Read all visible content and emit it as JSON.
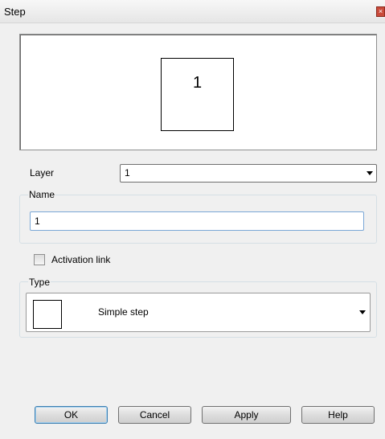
{
  "window": {
    "title": "Step"
  },
  "preview": {
    "step_label": "1"
  },
  "layer": {
    "label": "Layer",
    "selected": "1"
  },
  "name": {
    "group_title": "Name",
    "value": "1"
  },
  "activation_link": {
    "label": "Activation link",
    "checked": false
  },
  "type": {
    "group_title": "Type",
    "selected": "Simple step"
  },
  "buttons": {
    "ok": "OK",
    "cancel": "Cancel",
    "apply": "Apply",
    "help": "Help"
  },
  "icons": {
    "close": "close-icon",
    "dropdown": "chevron-down-icon"
  },
  "colors": {
    "default_button_border": "#3c7fb1",
    "textbox_border": "#7aa7d6"
  }
}
